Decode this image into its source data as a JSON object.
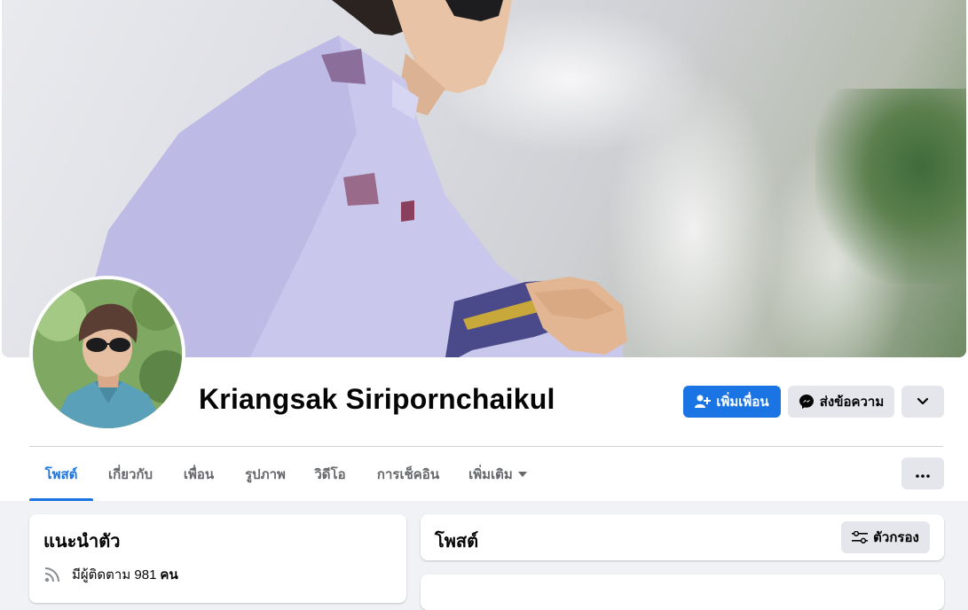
{
  "profile": {
    "name": "Kriangsak Siripornchaikul"
  },
  "actions": {
    "add_friend_label": "เพิ่มเพื่อน",
    "message_label": "ส่งข้อความ"
  },
  "tabs": [
    {
      "label": "โพสต์",
      "active": true
    },
    {
      "label": "เกี่ยวกับ",
      "active": false
    },
    {
      "label": "เพื่อน",
      "active": false
    },
    {
      "label": "รูปภาพ",
      "active": false
    },
    {
      "label": "วิดีโอ",
      "active": false
    },
    {
      "label": "การเช็คอิน",
      "active": false
    },
    {
      "label": "เพิ่มเติม",
      "active": false
    }
  ],
  "intro": {
    "title": "แนะนำตัว",
    "followers_prefix": "มีผู้ติดตาม 981",
    "followers_unit": "คน"
  },
  "posts": {
    "title": "โพสต์",
    "filter_label": "ตัวกรอง"
  },
  "colors": {
    "accent": "#1b74e4",
    "page_bg": "#f0f2f5",
    "button_gray": "#e4e6eb"
  },
  "icons": {
    "add_friend": "person-plus-icon",
    "message": "messenger-icon",
    "dropdown": "chevron-down-icon",
    "more": "ellipsis-icon",
    "caret": "caret-down-icon",
    "followers": "rss-icon",
    "filter": "sliders-icon"
  }
}
